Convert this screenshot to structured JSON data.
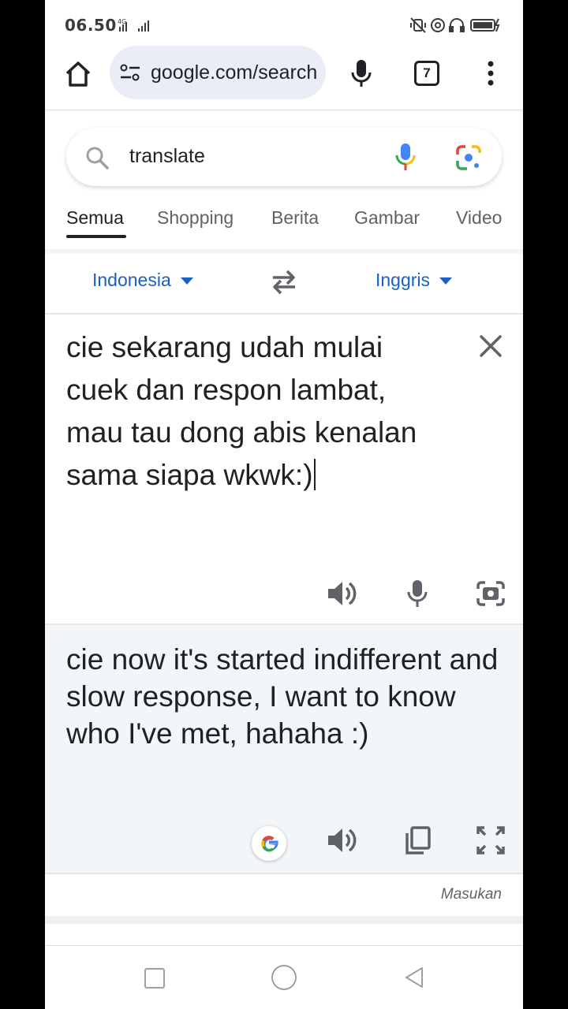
{
  "status_bar": {
    "time": "06.50",
    "network": "4G",
    "icons": [
      "vibrate-icon",
      "hotspot-icon",
      "headphones-icon",
      "battery-icon"
    ]
  },
  "browser": {
    "url": "google.com/search",
    "tab_count": "7"
  },
  "search": {
    "query": "translate"
  },
  "tabs": [
    {
      "label": "Semua",
      "active": true
    },
    {
      "label": "Shopping"
    },
    {
      "label": "Berita"
    },
    {
      "label": "Gambar"
    },
    {
      "label": "Video"
    }
  ],
  "translator": {
    "source_lang": "Indonesia",
    "target_lang": "Inggris",
    "source_text": "cie sekarang udah mulai cuek dan respon lambat, mau tau dong abis kenalan sama siapa wkwk:)",
    "output_text": "cie now it's started indifferent and slow response, I want to know who I've met, hahaha :)",
    "feedback_label": "Masukan"
  },
  "colors": {
    "link_blue": "#1a5fc4",
    "output_bg": "#f3f6f9"
  }
}
